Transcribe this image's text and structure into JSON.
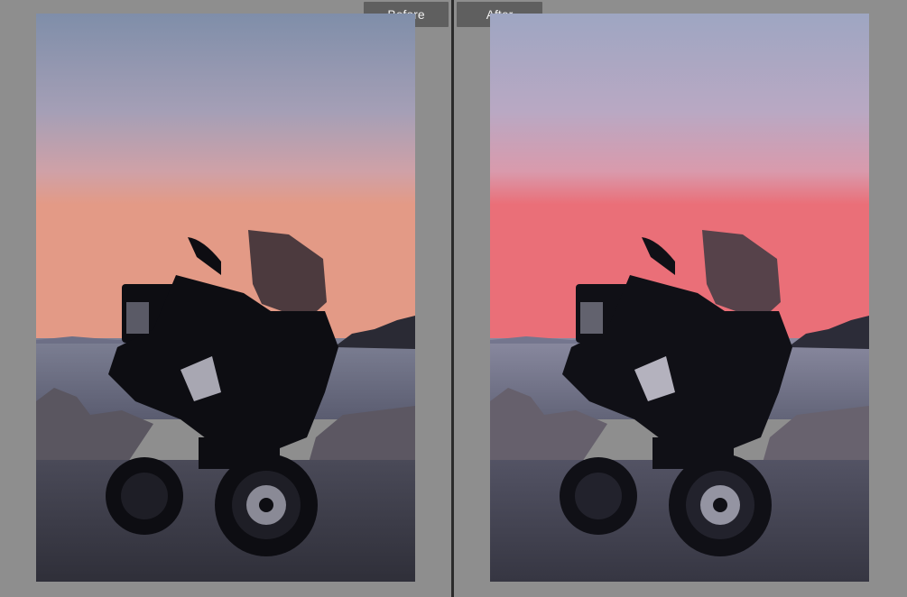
{
  "compare": {
    "before_label": "Before",
    "after_label": "After"
  },
  "colors": {
    "panel_bg": "#8e8e8e",
    "label_bg": "#5f5f5f",
    "label_text": "#f0f0f0",
    "before_sky": [
      "#7f8ea9",
      "#a59fb6",
      "#cfa1a7",
      "#e39a86"
    ],
    "after_sky": [
      "#9ea6c2",
      "#b9a8c3",
      "#d99aac",
      "#ea6f78"
    ]
  }
}
